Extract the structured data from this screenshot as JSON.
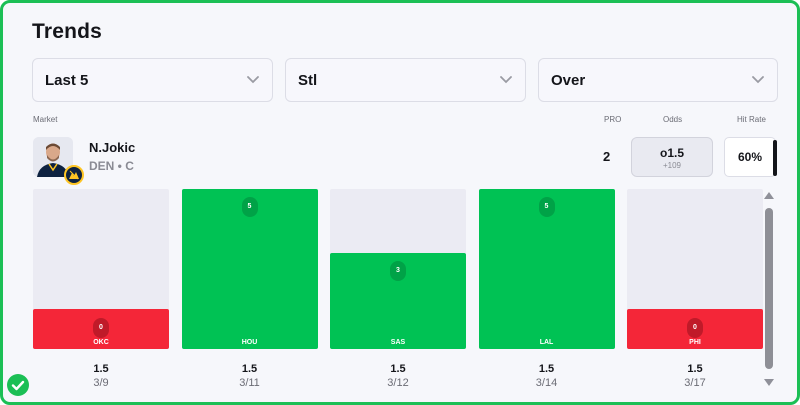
{
  "title": "Trends",
  "filters": {
    "range": "Last 5",
    "stat": "Stl",
    "direction": "Over"
  },
  "headers": {
    "market": "Market",
    "pro": "PRO",
    "odds": "Odds",
    "hit_rate": "Hit Rate"
  },
  "player": {
    "name": "N.Jokic",
    "meta": "DEN • C",
    "pro": "2",
    "odds_line": "o1.5",
    "odds_price": "+109",
    "hit_rate": "60%"
  },
  "colors": {
    "hit": "#00c254",
    "miss": "#f42638",
    "hit_pill": "#00a247",
    "miss_pill": "#c01a29",
    "empty": "#ebebf3"
  },
  "chart_data": {
    "type": "bar",
    "max_value": 5,
    "games": [
      {
        "opponent": "OKC",
        "value": 0,
        "line": "1.5",
        "date": "3/9",
        "result": "miss"
      },
      {
        "opponent": "HOU",
        "value": 5,
        "line": "1.5",
        "date": "3/11",
        "result": "hit"
      },
      {
        "opponent": "SAS",
        "value": 3,
        "line": "1.5",
        "date": "3/12",
        "result": "hit"
      },
      {
        "opponent": "LAL",
        "value": 5,
        "line": "1.5",
        "date": "3/14",
        "result": "hit"
      },
      {
        "opponent": "PHI",
        "value": 0,
        "line": "1.5",
        "date": "3/17",
        "result": "miss"
      }
    ]
  },
  "icons": {
    "dropdown": "chevron-down-icon",
    "status": "check-circle-icon",
    "team": "nuggets-logo-icon",
    "player": "player-headshot-icon"
  }
}
